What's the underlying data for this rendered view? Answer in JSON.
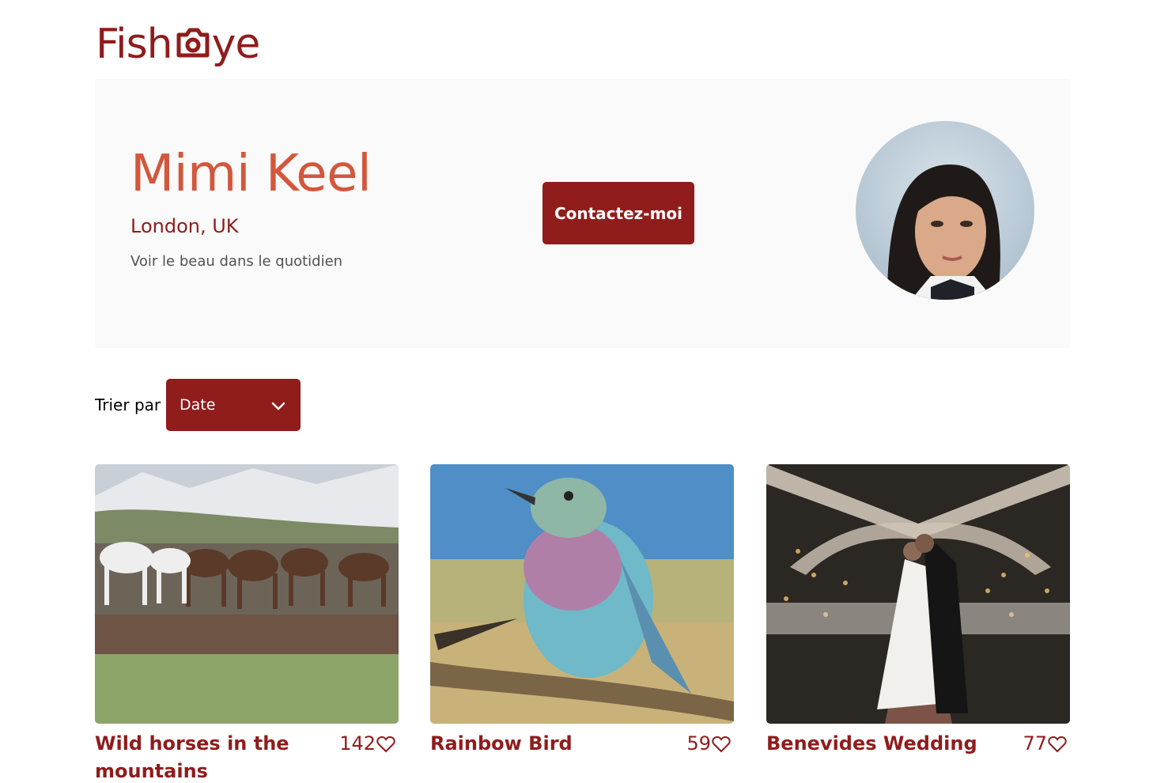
{
  "logo": {
    "part1": "Fish",
    "part2": "ye",
    "icon": "camera-icon",
    "color": "#901C1C"
  },
  "photographer": {
    "name": "Mimi Keel",
    "location": "London, UK",
    "tagline": "Voir le beau dans le quotidien",
    "contact_label": "Contactez-moi",
    "avatar": "portrait-photo"
  },
  "sort": {
    "label": "Trier par",
    "selected": "Date"
  },
  "media": [
    {
      "title": "Wild horses in the mountains",
      "likes": "142",
      "image": "horses-photo"
    },
    {
      "title": "Rainbow Bird",
      "likes": "59",
      "image": "bird-photo"
    },
    {
      "title": "Benevides Wedding",
      "likes": "77",
      "image": "wedding-photo"
    }
  ],
  "colors": {
    "primary": "#901C1C",
    "secondary": "#D3573C",
    "banner_bg": "#FAFAFA",
    "text_grey": "#525252"
  }
}
